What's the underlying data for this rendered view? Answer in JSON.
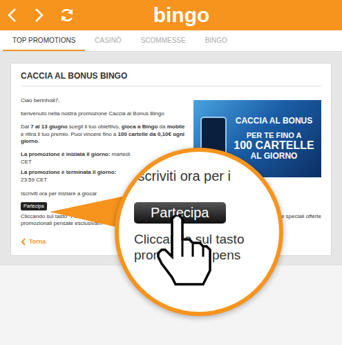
{
  "header": {
    "logo": "bingo"
  },
  "tabs": [
    {
      "label": "TOP PROMOTIONS",
      "selected": true
    },
    {
      "label": "CASINÒ",
      "selected": false
    },
    {
      "label": "SCOMMESSE",
      "selected": false
    },
    {
      "label": "BINGO",
      "selected": false
    }
  ],
  "promo": {
    "title": "CACCIA AL BONUS BINGO",
    "greeting": "Ciao berinho87,",
    "welcome": "benvenuto nella nostra promozione Caccia al Bonus Bingo",
    "description": [
      {
        "text": "Dal ",
        "bold": false
      },
      {
        "text": "7 al 13 giugno",
        "bold": true
      },
      {
        "text": " scegli il tuo obiettivo, ",
        "bold": false
      },
      {
        "text": "gioca a Bingo",
        "bold": true
      },
      {
        "text": " da ",
        "bold": false
      },
      {
        "text": "mobile",
        "bold": true
      },
      {
        "text": " e ritira il tuo premio. Puoi vincere fino a ",
        "bold": false
      },
      {
        "text": "100 cartelle da 0,10€ ogni giorno",
        "bold": true
      },
      {
        "text": ".",
        "bold": false
      }
    ],
    "dates": [
      {
        "label": "La promozione è iniziata il giorno:",
        "value": " martedì",
        "time": "CET"
      },
      {
        "label": "La promozione è terminata il giorno:",
        "time": "23:59 CET"
      }
    ],
    "cta": "Iscriviti ora per iniziare a giocar",
    "button": "Partecipa",
    "note": "Cliccando sul tasto \"Partecipa\"",
    "note_right": "le speciali offerte",
    "note2": "promozionali pensate esclusivam",
    "back": "Torna"
  },
  "banner": {
    "title": "CACCIA AL BONUS",
    "line1": "PER TE FINO A",
    "line2": "100 CARTELLE",
    "line3": "AL GIORNO"
  },
  "magnifier": {
    "cta": "Iscriviti ora per i",
    "button": "Partecipa",
    "note": "Cliccando sul tasto",
    "note2": "promozionali pens"
  }
}
